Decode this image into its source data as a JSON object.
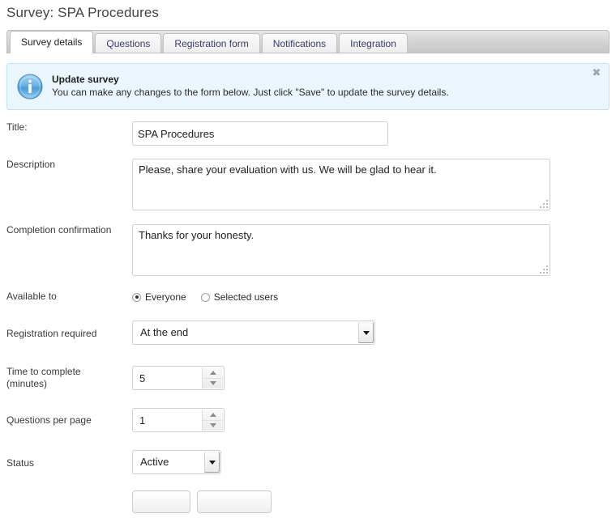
{
  "page": {
    "title": "Survey: SPA Procedures"
  },
  "tabs": [
    {
      "label": "Survey details",
      "active": true
    },
    {
      "label": "Questions",
      "active": false
    },
    {
      "label": "Registration form",
      "active": false
    },
    {
      "label": "Notifications",
      "active": false
    },
    {
      "label": "Integration",
      "active": false
    }
  ],
  "banner": {
    "icon": "info-icon",
    "title": "Update survey",
    "message": "You can make any changes to the form below. Just click \"Save\" to update the survey details.",
    "close_label": "✖",
    "background_color": "#eaf6fd",
    "border_color": "#bfe4f8"
  },
  "form": {
    "title": {
      "label": "Title:",
      "value": "SPA Procedures",
      "placeholder": ""
    },
    "description": {
      "label": "Description",
      "value": "Please, share your evaluation with us. We will be glad to hear it.",
      "placeholder": ""
    },
    "completion_confirmation": {
      "label": "Completion confirmation",
      "value": "Thanks for your honesty.",
      "placeholder": ""
    },
    "available_to": {
      "label": "Available to",
      "options": [
        {
          "label": "Everyone",
          "selected": true
        },
        {
          "label": "Selected users",
          "selected": false
        }
      ]
    },
    "registration_required": {
      "label": "Registration required",
      "value": "At the end"
    },
    "time_to_complete": {
      "label_line1": "Time to complete",
      "label_line2": "(minutes)",
      "value": "5"
    },
    "questions_per_page": {
      "label": "Questions per page",
      "value": "1"
    },
    "status": {
      "label": "Status",
      "value": "Active"
    }
  },
  "footer": {
    "primary_button": "",
    "secondary_button": ""
  }
}
